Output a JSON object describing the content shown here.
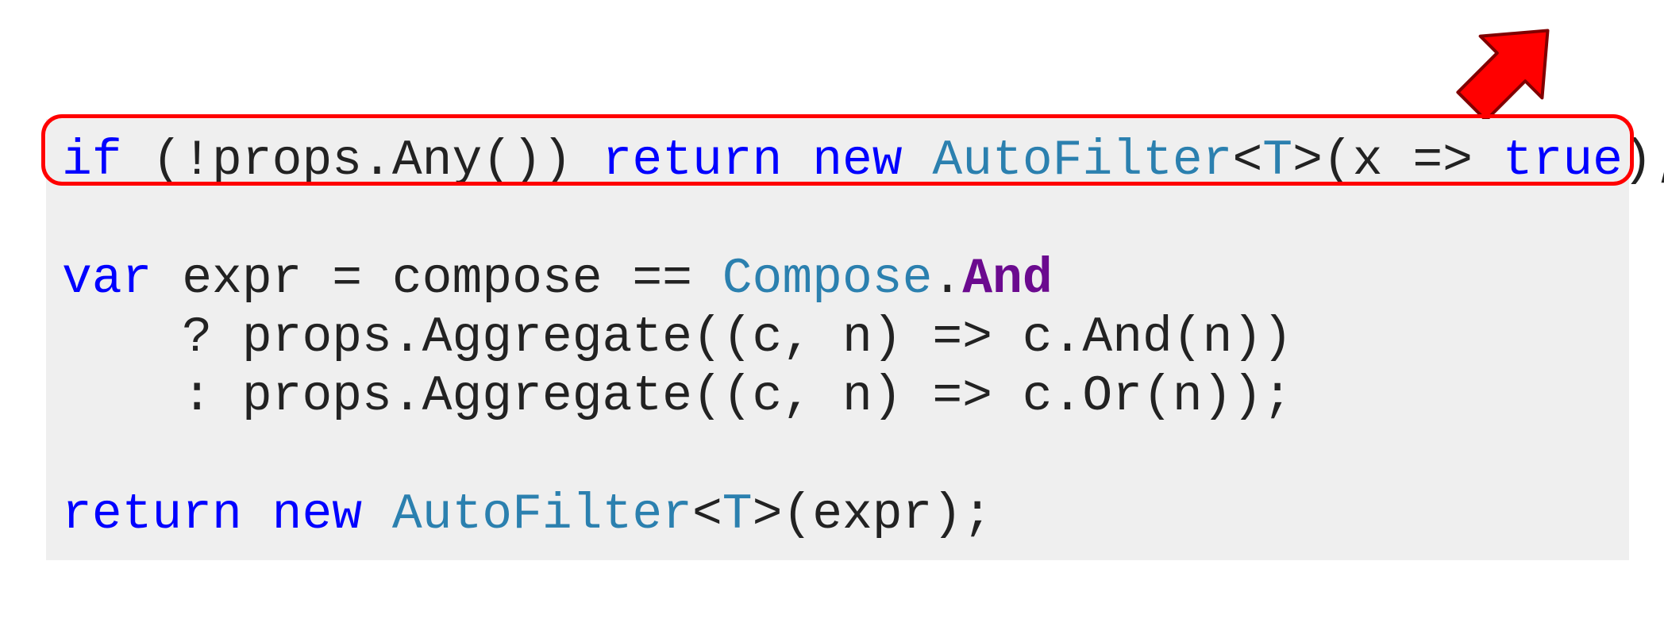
{
  "code": {
    "lines": [
      {
        "id": 1,
        "highlighted": true,
        "tokens": [
          {
            "t": "if",
            "c": "kw"
          },
          {
            "t": " (!props.Any()) ",
            "c": "txt"
          },
          {
            "t": "return",
            "c": "kw"
          },
          {
            "t": " ",
            "c": "txt"
          },
          {
            "t": "new",
            "c": "kw"
          },
          {
            "t": " ",
            "c": "txt"
          },
          {
            "t": "AutoFilter",
            "c": "typ"
          },
          {
            "t": "<",
            "c": "txt"
          },
          {
            "t": "T",
            "c": "typ"
          },
          {
            "t": ">(x => ",
            "c": "txt"
          },
          {
            "t": "true",
            "c": "kw"
          },
          {
            "t": ");",
            "c": "txt"
          }
        ]
      },
      {
        "id": 2,
        "blank": true
      },
      {
        "id": 3,
        "tokens": [
          {
            "t": "var",
            "c": "kw"
          },
          {
            "t": " expr = compose == ",
            "c": "txt"
          },
          {
            "t": "Compose",
            "c": "typ"
          },
          {
            "t": ".",
            "c": "txt"
          },
          {
            "t": "And",
            "c": "mem"
          }
        ]
      },
      {
        "id": 4,
        "tokens": [
          {
            "t": "    ? props.Aggregate((c, n) => c.And(n))",
            "c": "txt"
          }
        ]
      },
      {
        "id": 5,
        "tokens": [
          {
            "t": "    : props.Aggregate((c, n) => c.Or(n));",
            "c": "txt"
          }
        ]
      },
      {
        "id": 6,
        "blank": true
      },
      {
        "id": 7,
        "tokens": [
          {
            "t": "return",
            "c": "kw"
          },
          {
            "t": " ",
            "c": "txt"
          },
          {
            "t": "new",
            "c": "kw"
          },
          {
            "t": " ",
            "c": "txt"
          },
          {
            "t": "AutoFilter",
            "c": "typ"
          },
          {
            "t": "<",
            "c": "txt"
          },
          {
            "t": "T",
            "c": "typ"
          },
          {
            "t": ">(expr);",
            "c": "txt"
          }
        ]
      }
    ]
  },
  "annotations": {
    "arrow_name": "callout-arrow-icon",
    "highlight_name": "highlight-box"
  }
}
